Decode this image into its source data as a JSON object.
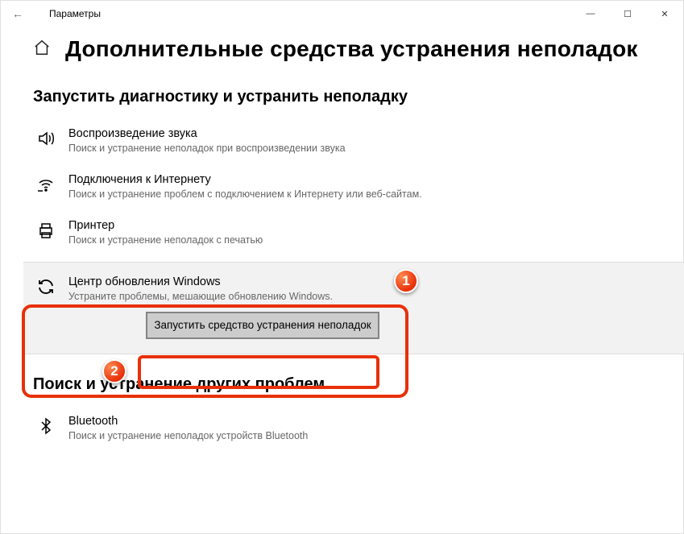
{
  "titlebar": {
    "back_arrow": "←",
    "app_title": "Параметры",
    "minimize": "—",
    "maximize": "☐",
    "close": "✕"
  },
  "header": {
    "home_icon": "⌂",
    "page_title": "Дополнительные средства устранения неполадок"
  },
  "section1": {
    "title": "Запустить диагностику и устранить неполадку",
    "items": [
      {
        "title": "Воспроизведение звука",
        "desc": "Поиск и устранение неполадок при воспроизведении звука"
      },
      {
        "title": "Подключения к Интернету",
        "desc": "Поиск и устранение проблем с подключением к Интернету или веб-сайтам."
      },
      {
        "title": "Принтер",
        "desc": "Поиск и устранение неполадок с печатью"
      },
      {
        "title": "Центр обновления Windows",
        "desc": "Устраните проблемы, мешающие обновлению Windows."
      }
    ],
    "run_button": "Запустить средство устранения неполадок"
  },
  "section2": {
    "title": "Поиск и устранение других проблем",
    "items": [
      {
        "title": "Bluetooth",
        "desc": "Поиск и устранение неполадок устройств Bluetooth"
      }
    ]
  },
  "badges": {
    "one": "1",
    "two": "2"
  }
}
